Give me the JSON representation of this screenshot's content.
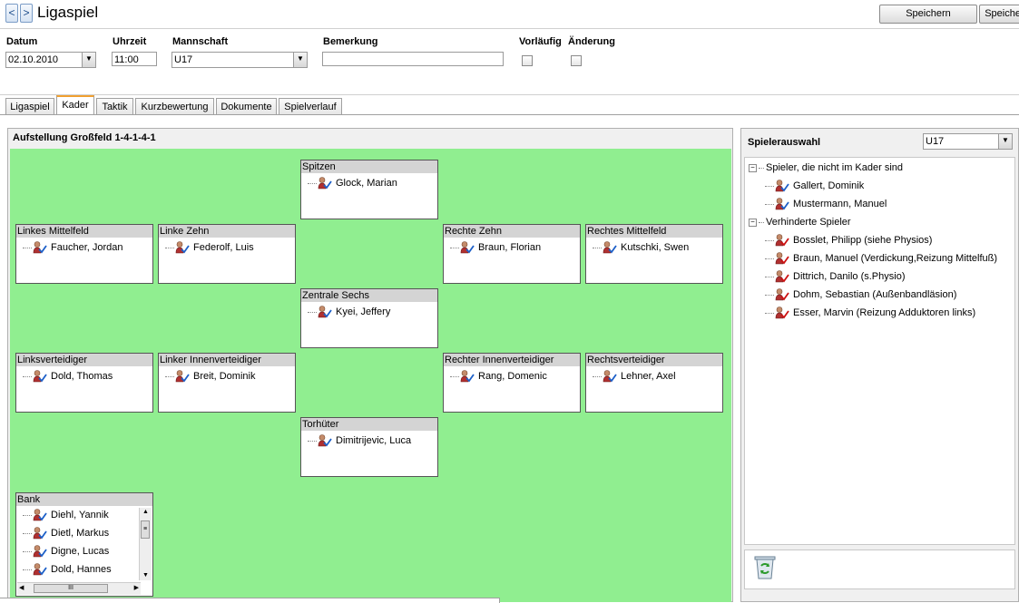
{
  "header": {
    "back_label": "<",
    "forward_label": ">",
    "title": "Ligaspiel",
    "save_label_1": "Speichern",
    "save_label_2": "Speichern"
  },
  "form": {
    "datum_label": "Datum",
    "datum_value": "02.10.2010",
    "uhrzeit_label": "Uhrzeit",
    "uhrzeit_value": "11:00",
    "mannschaft_label": "Mannschaft",
    "mannschaft_value": "U17",
    "bemerkung_label": "Bemerkung",
    "bemerkung_value": "",
    "vorlaeufig_label": "Vorläufig",
    "aenderung_label": "Änderung"
  },
  "tabs": [
    {
      "label": "Ligaspiel"
    },
    {
      "label": "Kader"
    },
    {
      "label": "Taktik"
    },
    {
      "label": "Kurzbewertung"
    },
    {
      "label": "Dokumente"
    },
    {
      "label": "Spielverlauf"
    }
  ],
  "lineup": {
    "title": "Aufstellung Großfeld 1-4-1-4-1",
    "positions": [
      {
        "name": "Spitzen",
        "player": "Glock, Marian"
      },
      {
        "name": "Linkes Mittelfeld",
        "player": "Faucher, Jordan"
      },
      {
        "name": "Linke Zehn",
        "player": "Federolf, Luis"
      },
      {
        "name": "Rechte Zehn",
        "player": "Braun, Florian"
      },
      {
        "name": "Rechtes Mittelfeld",
        "player": "Kutschki, Swen"
      },
      {
        "name": "Zentrale Sechs",
        "player": "Kyei, Jeffery"
      },
      {
        "name": "Linksverteidiger",
        "player": "Dold, Thomas"
      },
      {
        "name": "Linker Innenverteidiger",
        "player": "Breit, Dominik"
      },
      {
        "name": "Rechter Innenverteidiger",
        "player": "Rang, Domenic"
      },
      {
        "name": "Rechtsverteidiger",
        "player": "Lehner, Axel"
      },
      {
        "name": "Torhüter",
        "player": "Dimitrijevic, Luca"
      }
    ],
    "bench": {
      "label": "Bank",
      "players": [
        "Diehl, Yannik",
        "Dietl, Markus",
        "Digne, Lucas",
        "Dold, Hannes"
      ]
    }
  },
  "selection": {
    "title": "Spielerauswahl",
    "team_value": "U17",
    "groups": [
      {
        "label": "Spieler, die nicht im Kader sind",
        "players": [
          "Gallert, Dominik",
          "Mustermann, Manuel"
        ]
      },
      {
        "label": "Verhinderte Spieler",
        "players": [
          "Bosslet, Philipp (siehe Physios)",
          "Braun, Manuel (Verdickung,Reizung Mittelfuß)",
          "Dittrich, Danilo (s.Physio)",
          "Dohm, Sebastian (Außenbandläsion)",
          "Esser, Marvin (Reizung Adduktoren links)"
        ]
      }
    ]
  },
  "icons": {
    "player_available": "player-check-icon",
    "player_blocked": "player-red-check-icon",
    "trash": "recycle-bin-icon"
  }
}
